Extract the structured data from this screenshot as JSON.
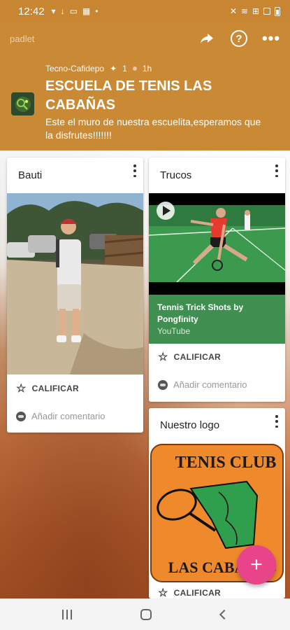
{
  "status_bar": {
    "time": "12:42",
    "notification_icons": [
      "notification-icon",
      "download-icon",
      "cast-icon",
      "qr-icon"
    ],
    "extra_dot": "•",
    "right_icons": [
      "mute-icon",
      "wifi-icon",
      "volte-icon",
      "signal-icon",
      "battery-icon"
    ]
  },
  "header": {
    "brand": "padlet",
    "author": "Tecno-Cafidepo",
    "likes": "1",
    "age": "1h",
    "title": "ESCUELA DE TENIS LAS CABAÑAS",
    "description": "Este el muro de nuestra escuelita,esperamos que la disfrutes!!!!!!!",
    "actions": [
      "share-icon",
      "help-icon",
      "more-icon"
    ]
  },
  "cards": {
    "bauti": {
      "title": "Bauti",
      "rate_label": "CALIFICAR",
      "comment_placeholder": "Añadir comentario"
    },
    "trucos": {
      "title": "Trucos",
      "video_title": "Tennis Trick Shots by Pongfinity",
      "video_source": "YouTube",
      "rate_label": "CALIFICAR",
      "comment_placeholder": "Añadir comentario"
    },
    "logo": {
      "title": "Nuestro logo",
      "image_text_top": "TENIS CLUB",
      "image_text_bottom": "LAS CABAÑAS",
      "rate_label": "CALIFICAR"
    }
  },
  "fab": {
    "label": "+"
  },
  "colors": {
    "header_bg": "#c98935",
    "fab": "#e8448a",
    "video_info_bg": "#3f8f50",
    "logo_orange": "#ee8a2c",
    "logo_green": "#2f9e4d"
  }
}
